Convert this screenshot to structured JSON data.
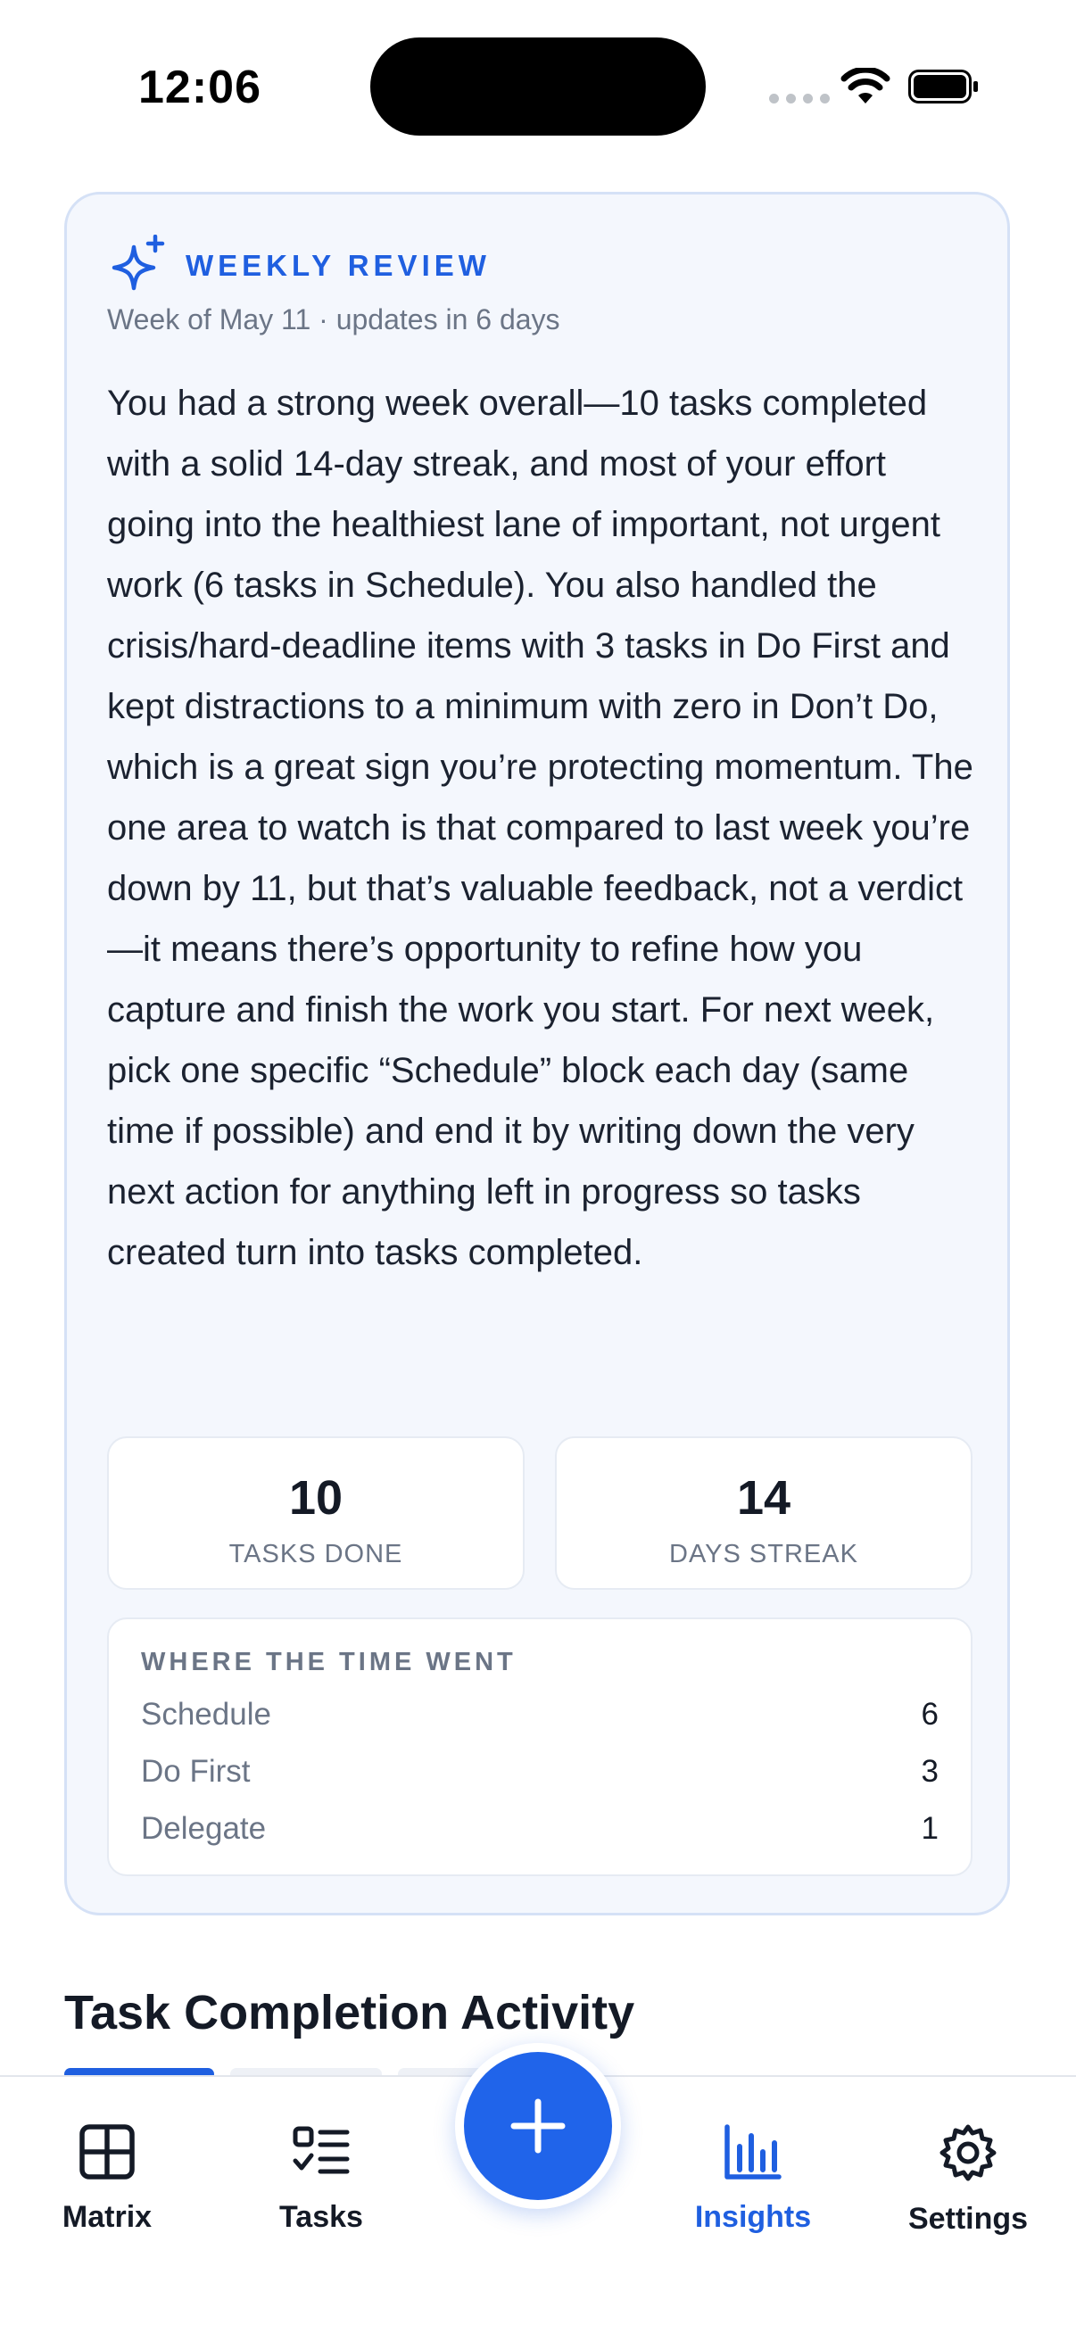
{
  "status": {
    "time": "12:06"
  },
  "review": {
    "title": "WEEKLY REVIEW",
    "subtitle": "Week of May 11 · updates in 6 days",
    "body": "You had a strong week overall—10 tasks completed with a solid 14-day streak, and most of your effort going into the healthiest lane of important, not urgent work (6 tasks in Schedule). You also handled the crisis/hard-deadline items with 3 tasks in Do First and kept distractions to a minimum with zero in Don’t Do, which is a great sign you’re protecting momentum. The one area to watch is that compared to last week you’re down by 11, but that’s valuable feedback, not a verdict—it means there’s opportunity to refine how you capture and finish the work you start. For next week, pick one specific “Schedule” block each day (same time if possible) and end it by writing down the very next action for anything left in progress so tasks created turn into tasks completed.",
    "stats": [
      {
        "value": "10",
        "label": "TASKS DONE"
      },
      {
        "value": "14",
        "label": "DAYS STREAK"
      }
    ],
    "breakdown": {
      "title": "WHERE THE TIME WENT",
      "rows": [
        {
          "name": "Schedule",
          "value": "6"
        },
        {
          "name": "Do First",
          "value": "3"
        },
        {
          "name": "Delegate",
          "value": "1"
        }
      ]
    }
  },
  "section": {
    "title": "Task Completion Activity"
  },
  "tabs": [
    {
      "label": "Matrix",
      "icon": "grid-icon"
    },
    {
      "label": "Tasks",
      "icon": "checklist-icon"
    },
    {
      "label": "Insights",
      "icon": "bar-chart-icon",
      "active": true
    },
    {
      "label": "Settings",
      "icon": "gear-icon"
    }
  ],
  "colors": {
    "accent": "#1f5fe0",
    "card_bg": "#f4f7fd",
    "card_border": "#d5e1f6"
  }
}
